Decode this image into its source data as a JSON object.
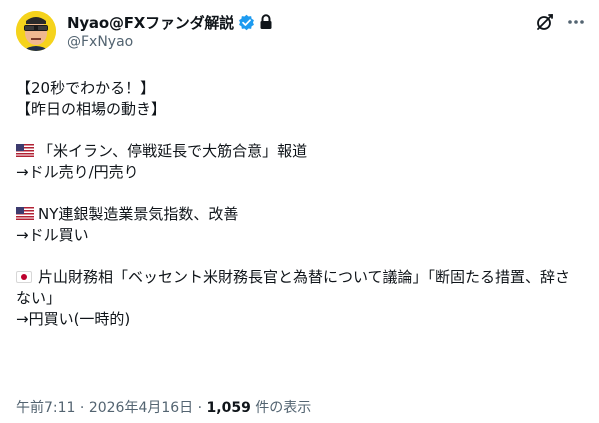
{
  "author": {
    "display_name": "Nyao@FXファンダ解説",
    "handle": "@FxNyao"
  },
  "tweet": {
    "line1": "【20秒でわかる！】",
    "line2": "【昨日の相場の動き】",
    "item1_headline": "「米イラン、停戦延長で大筋合意」報道",
    "item1_effect": "→ドル売り/円売り",
    "item2_headline": "NY連銀製造業景気指数、改善",
    "item2_effect": "→ドル買い",
    "item3_headline": "片山財務相「ベッセント米財務長官と為替について議論」「断固たる措置、辞さない」",
    "item3_effect": "→円買い(一時的)"
  },
  "meta": {
    "time": "午前7:11",
    "separator": " · ",
    "date": "2026年4月16日",
    "views_count": "1,059",
    "views_label": " 件の表示"
  },
  "icons": {
    "verified": "verified-badge-icon",
    "lock": "lock-icon",
    "grok": "grok-icon",
    "more": "more-icon"
  },
  "colors": {
    "verified": "#1d9bf0",
    "secondary_text": "#536471",
    "avatar_bg": "#f5d31c"
  }
}
